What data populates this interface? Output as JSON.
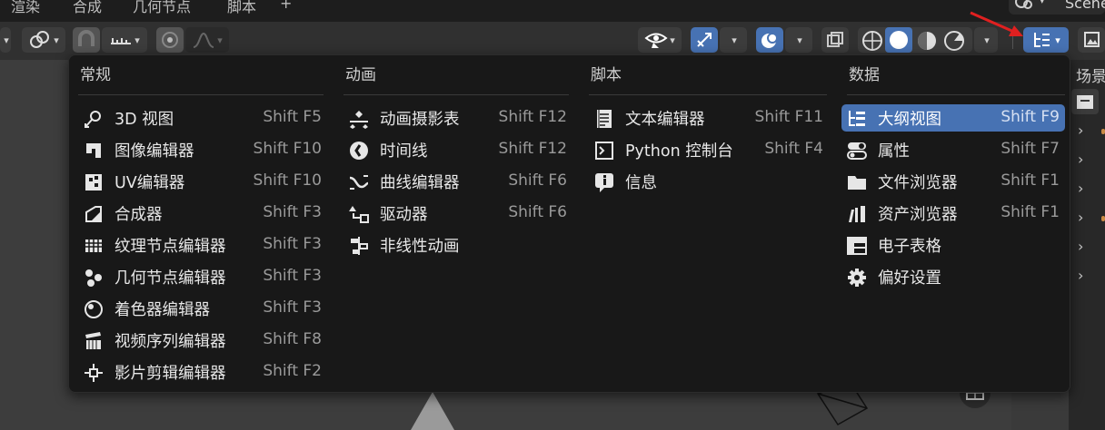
{
  "tabs": [
    "渲染",
    "合成",
    "几何节点",
    "脚本"
  ],
  "add_tab_label": "+",
  "scene_name": "Scene",
  "outliner_label": "场景",
  "menu": {
    "columns": [
      {
        "title": "常规",
        "items": [
          {
            "label": "3D 视图",
            "shortcut": "Shift F5",
            "icon": "3d-viewport-icon"
          },
          {
            "label": "图像编辑器",
            "shortcut": "Shift F10",
            "icon": "image-editor-icon"
          },
          {
            "label": "UV编辑器",
            "shortcut": "Shift F10",
            "icon": "uv-editor-icon"
          },
          {
            "label": "合成器",
            "shortcut": "Shift F3",
            "icon": "compositor-icon"
          },
          {
            "label": "纹理节点编辑器",
            "shortcut": "Shift F3",
            "icon": "texture-node-icon"
          },
          {
            "label": "几何节点编辑器",
            "shortcut": "Shift F3",
            "icon": "geometry-node-icon"
          },
          {
            "label": "着色器编辑器",
            "shortcut": "Shift F3",
            "icon": "shader-editor-icon"
          },
          {
            "label": "视频序列编辑器",
            "shortcut": "Shift F8",
            "icon": "sequencer-icon"
          },
          {
            "label": "影片剪辑编辑器",
            "shortcut": "Shift F2",
            "icon": "clip-editor-icon"
          }
        ]
      },
      {
        "title": "动画",
        "items": [
          {
            "label": "动画摄影表",
            "shortcut": "Shift F12",
            "icon": "dopesheet-icon"
          },
          {
            "label": "时间线",
            "shortcut": "Shift F12",
            "icon": "timeline-icon"
          },
          {
            "label": "曲线编辑器",
            "shortcut": "Shift F6",
            "icon": "graph-editor-icon"
          },
          {
            "label": "驱动器",
            "shortcut": "Shift F6",
            "icon": "drivers-icon"
          },
          {
            "label": "非线性动画",
            "shortcut": "",
            "icon": "nla-icon"
          }
        ]
      },
      {
        "title": "脚本",
        "items": [
          {
            "label": "文本编辑器",
            "shortcut": "Shift F11",
            "icon": "text-editor-icon"
          },
          {
            "label": "Python 控制台",
            "shortcut": "Shift F4",
            "icon": "console-icon"
          },
          {
            "label": "信息",
            "shortcut": "",
            "icon": "info-icon"
          }
        ]
      },
      {
        "title": "数据",
        "items": [
          {
            "label": "大纲视图",
            "shortcut": "Shift F9",
            "icon": "outliner-icon",
            "selected": true
          },
          {
            "label": "属性",
            "shortcut": "Shift F7",
            "icon": "properties-icon"
          },
          {
            "label": "文件浏览器",
            "shortcut": "Shift F1",
            "icon": "file-browser-icon"
          },
          {
            "label": "资产浏览器",
            "shortcut": "Shift F1",
            "icon": "asset-browser-icon"
          },
          {
            "label": "电子表格",
            "shortcut": "",
            "icon": "spreadsheet-icon"
          },
          {
            "label": "偏好设置",
            "shortcut": "",
            "icon": "preferences-icon"
          }
        ]
      }
    ]
  },
  "colors": {
    "menu_bg": "#181818",
    "selected_bg": "#4772b3",
    "header_bg": "#303030",
    "annotation_arrow": "#e02020"
  }
}
